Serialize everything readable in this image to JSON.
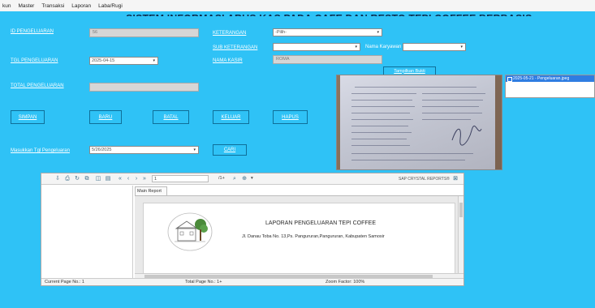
{
  "menu": {
    "items": [
      "kun",
      "Master",
      "Transaksi",
      "Laporan",
      "Laba/Rugi"
    ]
  },
  "title": "SISTEM INFORMASI ARUS KAS PADA CAFE DAN RESTO TEPI COFFEE BERBASIS DESKTOP",
  "form": {
    "id_label": "ID PENGELUARAN",
    "id_value": "56",
    "tgl_label": "TGL PENGELUARAN",
    "tgl_value": "2025-04-15",
    "total_label": "TOTAL PENGELUARAN",
    "total_value": "",
    "keterangan_label": "KETERANGAN",
    "keterangan_value": "-Pilih-",
    "sub_keterangan_label": "SUB KETERANGAN",
    "sub_keterangan_value": "",
    "nama_karyawan_label": "Nama Karyawan",
    "nama_karyawan_value": "",
    "nama_kasir_label": "NAMA KASIR",
    "nama_kasir_value": "ROMA",
    "tampilkan_bukti": "Tampilkan Bukti"
  },
  "buttons": {
    "simpan": "SIMPAN",
    "baru": "BARU",
    "batal": "BATAL",
    "keluar": "KELUAR",
    "hapus": "HAPUS",
    "cari": "CARI"
  },
  "search": {
    "label": "Masukkan Tgl Pengeluaran",
    "value": "5/26/2025"
  },
  "file_list": {
    "items": [
      "2025-05-21 - Pengeluaran.jpeg"
    ]
  },
  "viewer": {
    "page_input": "1",
    "page_count": "/1+",
    "brand": "SAP CRYSTAL REPORTS®",
    "tab": "Main Report",
    "report_title": "LAPORAN PENGELUARAN TEPI COFFEE",
    "report_address": "Jl. Danau Toba No. 13,Ps. Pangururan,Pangururan, Kabupaten Samosir",
    "status_current": "Current Page No.: 1",
    "status_total": "Total Page No.: 1+",
    "status_zoom": "Zoom Factor: 100%"
  },
  "colors": {
    "background": "#2fc2f6",
    "title": "#0b2d4f",
    "selection": "#2f7de1"
  }
}
